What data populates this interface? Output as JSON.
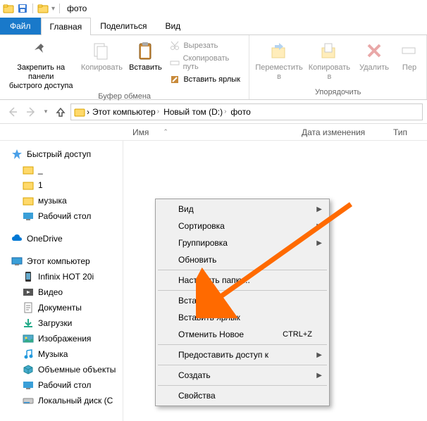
{
  "titlebar": {
    "title": "фото"
  },
  "tabs": {
    "file": "Файл",
    "home": "Главная",
    "share": "Поделиться",
    "view": "Вид"
  },
  "ribbon": {
    "pin": "Закрепить на панели\nбыстрого доступа",
    "copy": "Копировать",
    "paste": "Вставить",
    "cut": "Вырезать",
    "copypath": "Скопировать путь",
    "pasteshortcut": "Вставить ярлык",
    "group_clipboard": "Буфер обмена",
    "moveto": "Переместить\nв",
    "copyto": "Копировать\nв",
    "delete": "Удалить",
    "rename": "Пер",
    "group_organize": "Упорядочить"
  },
  "breadcrumb": {
    "pc": "Этот компьютер",
    "drive": "Новый том (D:)",
    "folder": "фото"
  },
  "columns": {
    "name": "Имя",
    "date": "Дата изменения",
    "type": "Тип"
  },
  "tree": {
    "quick": "Быстрый доступ",
    "folder_dash": "_",
    "folder_1": "1",
    "folder_music": "музыка",
    "desktop": "Рабочий стол",
    "onedrive": "OneDrive",
    "thispc": "Этот компьютер",
    "infinix": "Infinix HOT 20i",
    "videos": "Видео",
    "documents": "Документы",
    "downloads": "Загрузки",
    "pictures": "Изображения",
    "music": "Музыка",
    "objects3d": "Объемные объекты",
    "desktop2": "Рабочий стол",
    "localdisk": "Локальный диск (С"
  },
  "ctx": {
    "view": "Вид",
    "sort": "Сортировка",
    "group": "Группировка",
    "refresh": "Обновить",
    "customize": "Настроить папку...",
    "paste": "Вставить",
    "pasteshortcut": "Вставить ярлык",
    "undo": "Отменить Новое",
    "undo_sc": "CTRL+Z",
    "giveaccess": "Предоставить доступ к",
    "new": "Создать",
    "properties": "Свойства"
  }
}
